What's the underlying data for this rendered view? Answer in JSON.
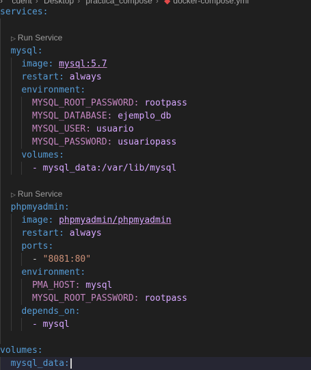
{
  "breadcrumb": [
    "cuent",
    "Desktop",
    "practica_compose",
    "docker-compose.yml"
  ],
  "code": {
    "services_key": "services:",
    "codelens_label": "Run Service",
    "mysql": {
      "name": "mysql:",
      "image_key": "image:",
      "image_val": "mysql:5.7",
      "restart_key": "restart:",
      "restart_val": "always",
      "env_key": "environment:",
      "env": [
        {
          "k": "MYSQL_ROOT_PASSWORD:",
          "v": "rootpass"
        },
        {
          "k": "MYSQL_DATABASE:",
          "v": "ejemplo_db"
        },
        {
          "k": "MYSQL_USER:",
          "v": "usuario"
        },
        {
          "k": "MYSQL_PASSWORD:",
          "v": "usuariopass"
        }
      ],
      "volumes_key": "volumes:",
      "volume_item": "- mysql_data:/var/lib/mysql"
    },
    "phpmyadmin": {
      "name": "phpmyadmin:",
      "image_key": "image:",
      "image_val": "phpmyadmin/phpmyadmin",
      "restart_key": "restart:",
      "restart_val": "always",
      "ports_key": "ports:",
      "port_dash": "- ",
      "port_val": "\"8081:80\"",
      "env_key": "environment:",
      "env": [
        {
          "k": "PMA_HOST:",
          "v": "mysql"
        },
        {
          "k": "MYSQL_ROOT_PASSWORD:",
          "v": "rootpass"
        }
      ],
      "depends_key": "depends_on:",
      "depends_item": "- mysql"
    },
    "volumes_key": "volumes:",
    "mysql_data_key": "mysql_data:"
  }
}
